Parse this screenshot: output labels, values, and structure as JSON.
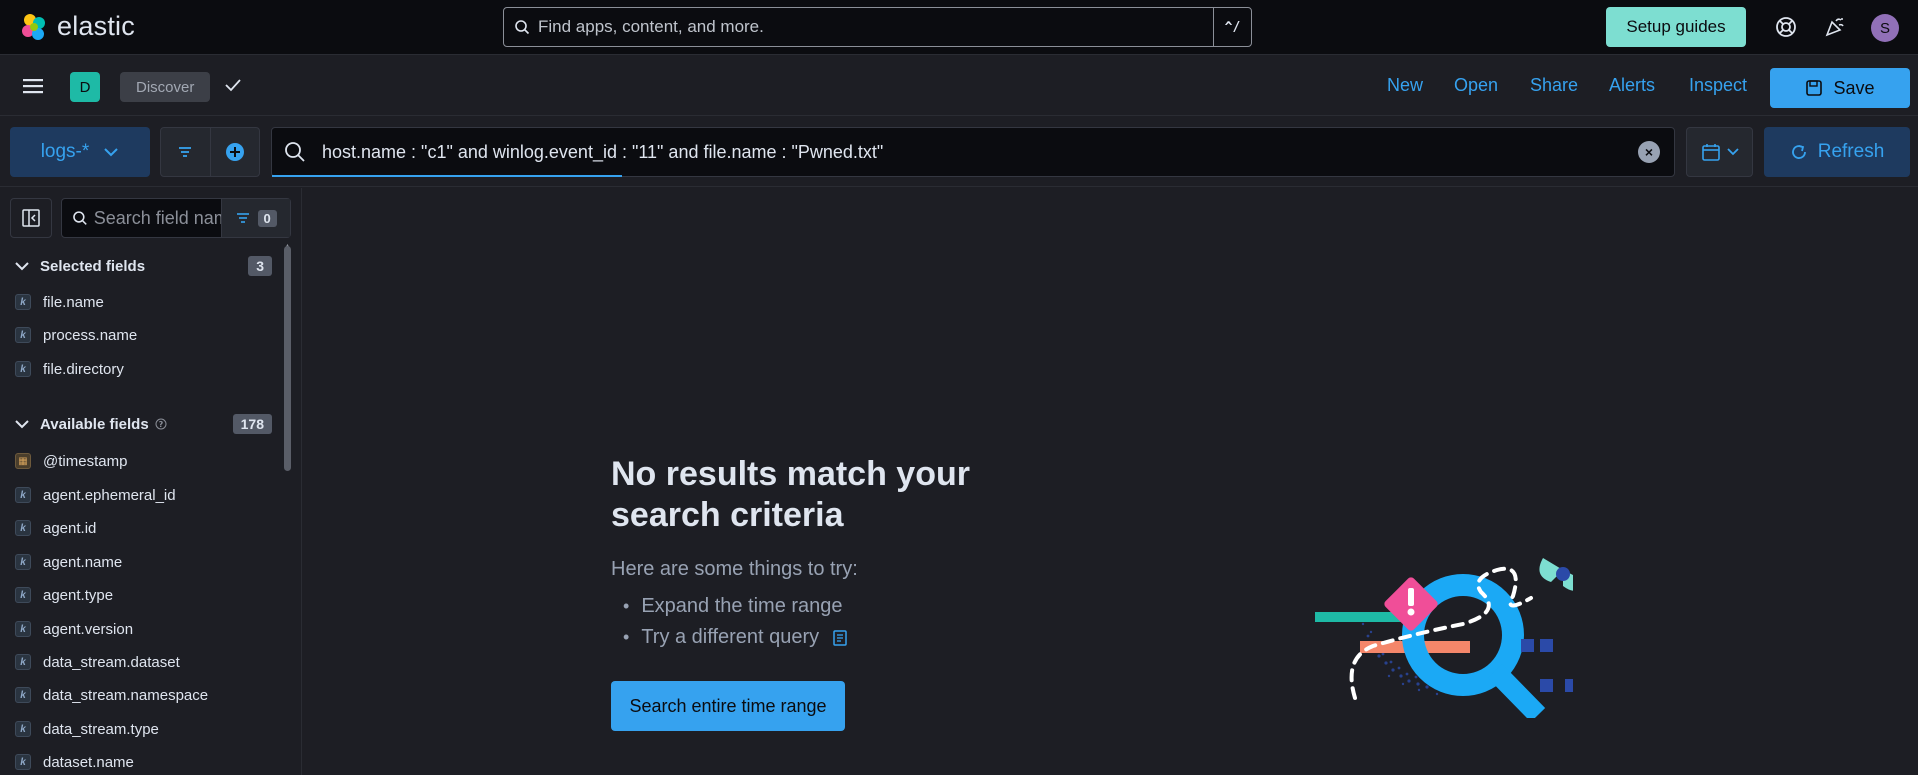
{
  "header": {
    "brand": "elastic",
    "search_placeholder": "Find apps, content, and more.",
    "search_shortcut": "^/",
    "setup_label": "Setup guides",
    "avatar_initial": "S"
  },
  "appbar": {
    "space_initial": "D",
    "breadcrumb": "Discover",
    "links": {
      "new": "New",
      "open": "Open",
      "share": "Share",
      "alerts": "Alerts",
      "inspect": "Inspect"
    },
    "save_label": "Save"
  },
  "querybar": {
    "data_view": "logs-*",
    "query": "host.name : \"c1\" and winlog.event_id : \"11\" and file.name : \"Pwned.txt\"",
    "refresh_label": "Refresh"
  },
  "sidebar": {
    "search_placeholder": "Search field names",
    "filter_count": "0",
    "selected_title": "Selected fields",
    "selected_count": "3",
    "selected_fields": [
      "file.name",
      "process.name",
      "file.directory"
    ],
    "available_title": "Available fields",
    "available_count": "178",
    "available_fields": [
      "@timestamp",
      "agent.ephemeral_id",
      "agent.id",
      "agent.name",
      "agent.type",
      "agent.version",
      "data_stream.dataset",
      "data_stream.namespace",
      "data_stream.type",
      "dataset.name"
    ]
  },
  "empty_state": {
    "title": "No results match your search criteria",
    "subtitle": "Here are some things to try:",
    "tips": [
      "Expand the time range",
      "Try a different query"
    ],
    "button": "Search entire time range"
  },
  "colors": {
    "accent": "#36a2ef",
    "teal": "#7dded1",
    "background": "#1d1e24",
    "topbar": "#0b0c10"
  }
}
